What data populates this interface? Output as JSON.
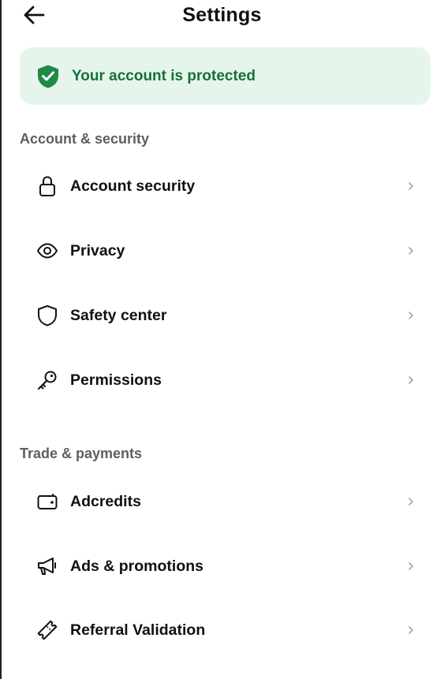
{
  "header": {
    "title": "Settings",
    "back_icon": "arrow-left-icon"
  },
  "banner": {
    "text": "Your account is protected",
    "icon": "shield-check-icon",
    "background": "#e6f5ec",
    "text_color": "#16703a",
    "icon_color": "#1e8a45"
  },
  "sections": [
    {
      "title": "Account & security",
      "items": [
        {
          "label": "Account security",
          "icon": "lock-icon"
        },
        {
          "label": "Privacy",
          "icon": "eye-icon"
        },
        {
          "label": "Safety center",
          "icon": "shield-icon"
        },
        {
          "label": "Permissions",
          "icon": "key-icon"
        }
      ]
    },
    {
      "title": "Trade & payments",
      "items": [
        {
          "label": "Adcredits",
          "icon": "wallet-icon"
        },
        {
          "label": "Ads & promotions",
          "icon": "megaphone-icon"
        },
        {
          "label": "Referral Validation",
          "icon": "ticket-icon"
        }
      ]
    }
  ]
}
